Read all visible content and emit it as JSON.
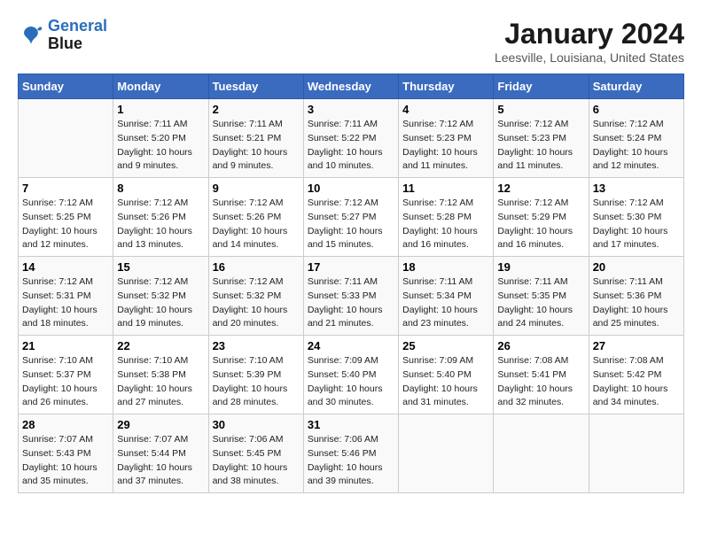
{
  "header": {
    "logo": {
      "line1": "General",
      "line2": "Blue"
    },
    "title": "January 2024",
    "location": "Leesville, Louisiana, United States"
  },
  "calendar": {
    "days_of_week": [
      "Sunday",
      "Monday",
      "Tuesday",
      "Wednesday",
      "Thursday",
      "Friday",
      "Saturday"
    ],
    "weeks": [
      [
        {
          "day": "",
          "info": ""
        },
        {
          "day": "1",
          "info": "Sunrise: 7:11 AM\nSunset: 5:20 PM\nDaylight: 10 hours\nand 9 minutes."
        },
        {
          "day": "2",
          "info": "Sunrise: 7:11 AM\nSunset: 5:21 PM\nDaylight: 10 hours\nand 9 minutes."
        },
        {
          "day": "3",
          "info": "Sunrise: 7:11 AM\nSunset: 5:22 PM\nDaylight: 10 hours\nand 10 minutes."
        },
        {
          "day": "4",
          "info": "Sunrise: 7:12 AM\nSunset: 5:23 PM\nDaylight: 10 hours\nand 11 minutes."
        },
        {
          "day": "5",
          "info": "Sunrise: 7:12 AM\nSunset: 5:23 PM\nDaylight: 10 hours\nand 11 minutes."
        },
        {
          "day": "6",
          "info": "Sunrise: 7:12 AM\nSunset: 5:24 PM\nDaylight: 10 hours\nand 12 minutes."
        }
      ],
      [
        {
          "day": "7",
          "info": "Sunrise: 7:12 AM\nSunset: 5:25 PM\nDaylight: 10 hours\nand 12 minutes."
        },
        {
          "day": "8",
          "info": "Sunrise: 7:12 AM\nSunset: 5:26 PM\nDaylight: 10 hours\nand 13 minutes."
        },
        {
          "day": "9",
          "info": "Sunrise: 7:12 AM\nSunset: 5:26 PM\nDaylight: 10 hours\nand 14 minutes."
        },
        {
          "day": "10",
          "info": "Sunrise: 7:12 AM\nSunset: 5:27 PM\nDaylight: 10 hours\nand 15 minutes."
        },
        {
          "day": "11",
          "info": "Sunrise: 7:12 AM\nSunset: 5:28 PM\nDaylight: 10 hours\nand 16 minutes."
        },
        {
          "day": "12",
          "info": "Sunrise: 7:12 AM\nSunset: 5:29 PM\nDaylight: 10 hours\nand 16 minutes."
        },
        {
          "day": "13",
          "info": "Sunrise: 7:12 AM\nSunset: 5:30 PM\nDaylight: 10 hours\nand 17 minutes."
        }
      ],
      [
        {
          "day": "14",
          "info": "Sunrise: 7:12 AM\nSunset: 5:31 PM\nDaylight: 10 hours\nand 18 minutes."
        },
        {
          "day": "15",
          "info": "Sunrise: 7:12 AM\nSunset: 5:32 PM\nDaylight: 10 hours\nand 19 minutes."
        },
        {
          "day": "16",
          "info": "Sunrise: 7:12 AM\nSunset: 5:32 PM\nDaylight: 10 hours\nand 20 minutes."
        },
        {
          "day": "17",
          "info": "Sunrise: 7:11 AM\nSunset: 5:33 PM\nDaylight: 10 hours\nand 21 minutes."
        },
        {
          "day": "18",
          "info": "Sunrise: 7:11 AM\nSunset: 5:34 PM\nDaylight: 10 hours\nand 23 minutes."
        },
        {
          "day": "19",
          "info": "Sunrise: 7:11 AM\nSunset: 5:35 PM\nDaylight: 10 hours\nand 24 minutes."
        },
        {
          "day": "20",
          "info": "Sunrise: 7:11 AM\nSunset: 5:36 PM\nDaylight: 10 hours\nand 25 minutes."
        }
      ],
      [
        {
          "day": "21",
          "info": "Sunrise: 7:10 AM\nSunset: 5:37 PM\nDaylight: 10 hours\nand 26 minutes."
        },
        {
          "day": "22",
          "info": "Sunrise: 7:10 AM\nSunset: 5:38 PM\nDaylight: 10 hours\nand 27 minutes."
        },
        {
          "day": "23",
          "info": "Sunrise: 7:10 AM\nSunset: 5:39 PM\nDaylight: 10 hours\nand 28 minutes."
        },
        {
          "day": "24",
          "info": "Sunrise: 7:09 AM\nSunset: 5:40 PM\nDaylight: 10 hours\nand 30 minutes."
        },
        {
          "day": "25",
          "info": "Sunrise: 7:09 AM\nSunset: 5:40 PM\nDaylight: 10 hours\nand 31 minutes."
        },
        {
          "day": "26",
          "info": "Sunrise: 7:08 AM\nSunset: 5:41 PM\nDaylight: 10 hours\nand 32 minutes."
        },
        {
          "day": "27",
          "info": "Sunrise: 7:08 AM\nSunset: 5:42 PM\nDaylight: 10 hours\nand 34 minutes."
        }
      ],
      [
        {
          "day": "28",
          "info": "Sunrise: 7:07 AM\nSunset: 5:43 PM\nDaylight: 10 hours\nand 35 minutes."
        },
        {
          "day": "29",
          "info": "Sunrise: 7:07 AM\nSunset: 5:44 PM\nDaylight: 10 hours\nand 37 minutes."
        },
        {
          "day": "30",
          "info": "Sunrise: 7:06 AM\nSunset: 5:45 PM\nDaylight: 10 hours\nand 38 minutes."
        },
        {
          "day": "31",
          "info": "Sunrise: 7:06 AM\nSunset: 5:46 PM\nDaylight: 10 hours\nand 39 minutes."
        },
        {
          "day": "",
          "info": ""
        },
        {
          "day": "",
          "info": ""
        },
        {
          "day": "",
          "info": ""
        }
      ]
    ]
  }
}
